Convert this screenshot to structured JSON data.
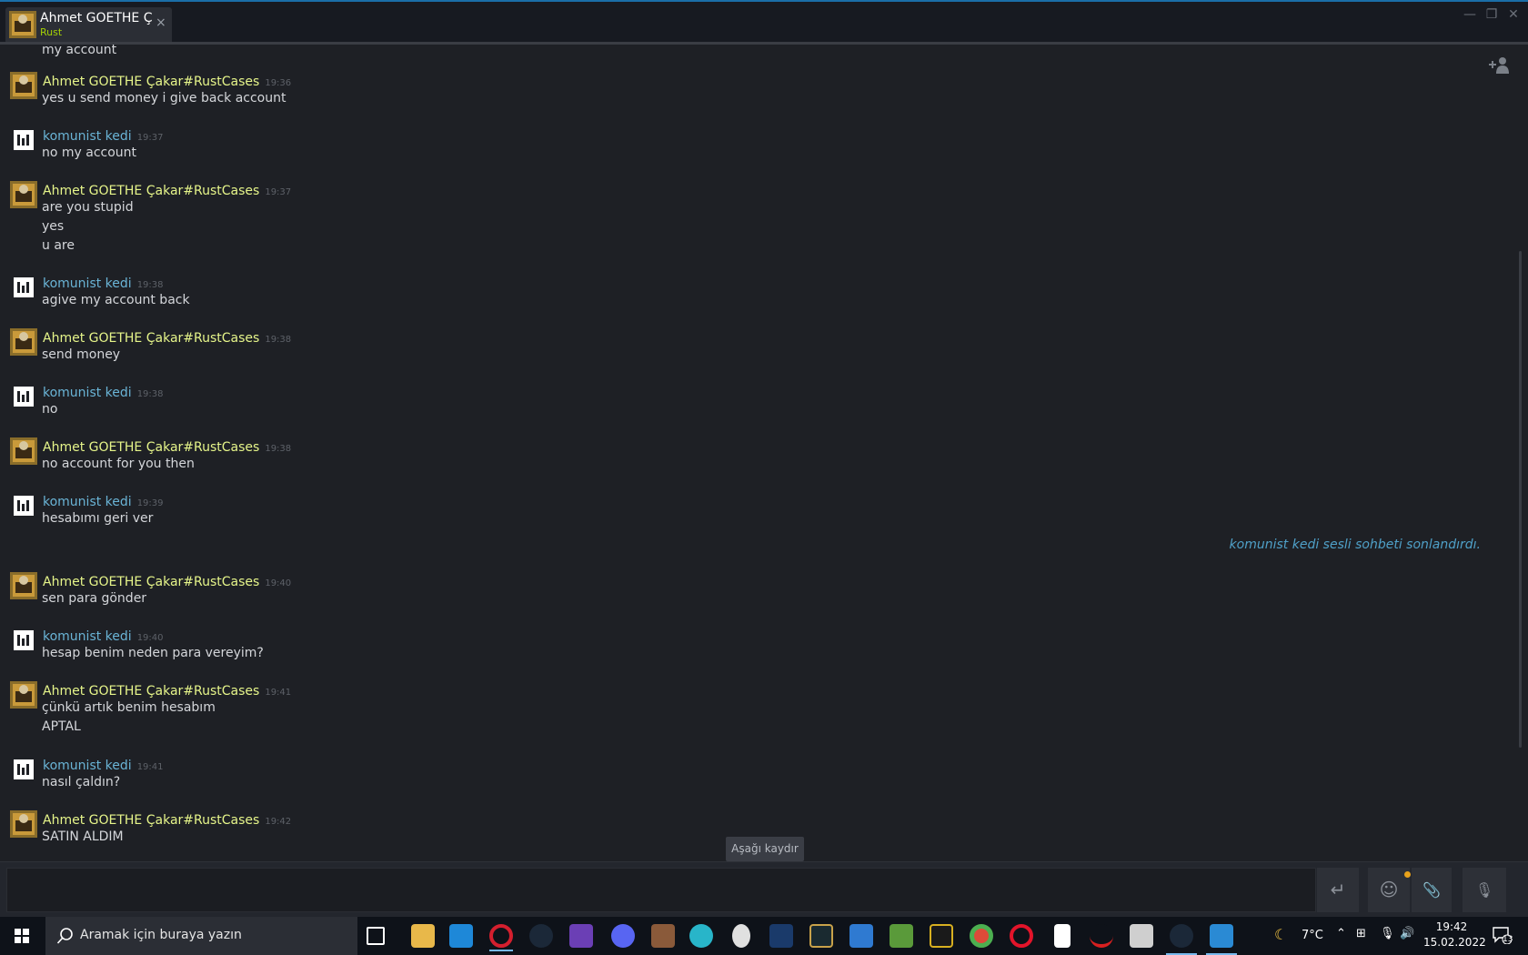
{
  "window": {
    "tab": {
      "name": "Ahmet GOETHE Ç",
      "game": "Rust",
      "close": "×"
    },
    "controls": {
      "minimize": "—",
      "maximize": "❐",
      "close": "✕"
    }
  },
  "chat": {
    "first_line": "my account",
    "messages": [
      {
        "sender": "Ahmet GOETHE Çakar#RustCases",
        "time": "19:36",
        "lines": [
          "yes u send money i give back account"
        ]
      },
      {
        "sender": "komunist kedi",
        "time": "19:37",
        "lines": [
          "no my account"
        ]
      },
      {
        "sender": "Ahmet GOETHE Çakar#RustCases",
        "time": "19:37",
        "lines": [
          "are you stupid",
          "yes",
          "u are"
        ]
      },
      {
        "sender": "komunist kedi",
        "time": "19:38",
        "lines": [
          "agive my account back"
        ]
      },
      {
        "sender": "Ahmet GOETHE Çakar#RustCases",
        "time": "19:38",
        "lines": [
          "send money"
        ]
      },
      {
        "sender": "komunist kedi",
        "time": "19:38",
        "lines": [
          "no"
        ]
      },
      {
        "sender": "Ahmet GOETHE Çakar#RustCases",
        "time": "19:38",
        "lines": [
          "no account for you then"
        ]
      },
      {
        "sender": "komunist kedi",
        "time": "19:39",
        "lines": [
          "hesabımı geri ver"
        ]
      },
      {
        "sender": "Ahmet GOETHE Çakar#RustCases",
        "time": "19:40",
        "lines": [
          "sen para gönder"
        ]
      },
      {
        "sender": "komunist kedi",
        "time": "19:40",
        "lines": [
          "hesap benim neden para vereyim?"
        ]
      },
      {
        "sender": "Ahmet GOETHE Çakar#RustCases",
        "time": "19:41",
        "lines": [
          "çünkü artık benim hesabım",
          "APTAL"
        ]
      },
      {
        "sender": "komunist kedi",
        "time": "19:41",
        "lines": [
          "nasıl çaldın?"
        ]
      },
      {
        "sender": "Ahmet GOETHE Çakar#RustCases",
        "time": "19:42",
        "lines": [
          "SATIN ALDIM"
        ]
      }
    ],
    "system_message": "komunist kedi sesli sohbeti sonlandırdı.",
    "scroll_down_label": "Aşağı kaydır"
  },
  "input": {
    "send_icon": "↵",
    "emoji_icon": "☺",
    "attach_icon": "📎",
    "voice_icon": "🎙"
  },
  "taskbar": {
    "search_placeholder": "Aramak için buraya yazın",
    "weather": "7°C",
    "time": "19:42",
    "date": "15.02.2022",
    "notification_count": "13",
    "accent_color": "#76b9ed"
  }
}
